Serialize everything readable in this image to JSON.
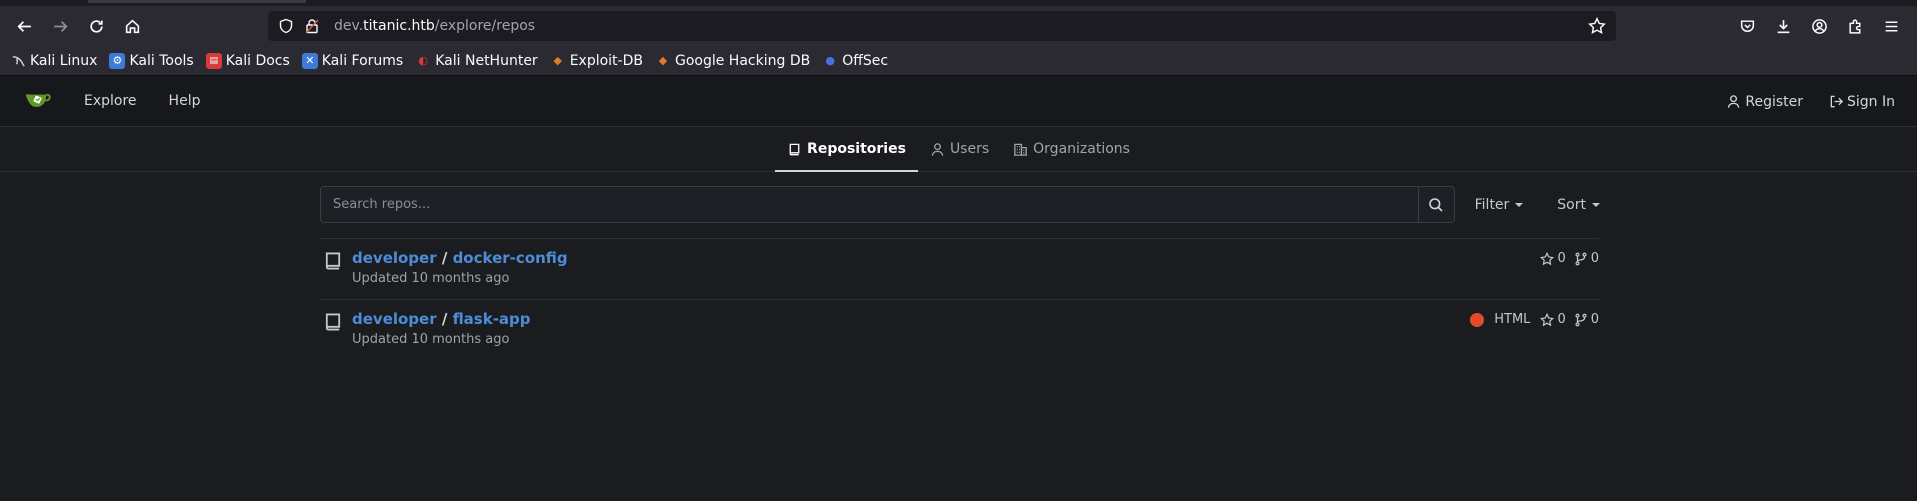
{
  "browser": {
    "url_prefix": "dev.",
    "url_domain": "titanic.htb",
    "url_path": "/explore/repos"
  },
  "bookmarks": [
    {
      "label": "Kali Linux",
      "icon": "kali-dragon-icon",
      "color": "#cfd2d8"
    },
    {
      "label": "Kali Tools",
      "icon": "kali-tools-icon",
      "color": "#3d7bd9"
    },
    {
      "label": "Kali Docs",
      "icon": "kali-docs-icon",
      "color": "#d93b3b"
    },
    {
      "label": "Kali Forums",
      "icon": "kali-forums-icon",
      "color": "#3d7bd9"
    },
    {
      "label": "Kali NetHunter",
      "icon": "nethunter-icon",
      "color": "#d93b3b"
    },
    {
      "label": "Exploit-DB",
      "icon": "exploitdb-icon",
      "color": "#e07a2e"
    },
    {
      "label": "Google Hacking DB",
      "icon": "ghdb-icon",
      "color": "#e07a2e"
    },
    {
      "label": "OffSec",
      "icon": "offsec-icon",
      "color": "#4a6fe0"
    }
  ],
  "header": {
    "explore": "Explore",
    "help": "Help",
    "register": "Register",
    "sign_in": "Sign In"
  },
  "tabs": {
    "repositories": "Repositories",
    "users": "Users",
    "organizations": "Organizations"
  },
  "search": {
    "placeholder": "Search repos...",
    "filter": "Filter",
    "sort": "Sort"
  },
  "repos": [
    {
      "owner": "developer",
      "name": "docker-config",
      "updated": "Updated 10 months ago",
      "language": "",
      "stars": "0",
      "forks": "0"
    },
    {
      "owner": "developer",
      "name": "flask-app",
      "updated": "Updated 10 months ago",
      "language": "HTML",
      "language_color": "#e34c26",
      "stars": "0",
      "forks": "0"
    }
  ],
  "colors": {
    "link": "#4d8cd6",
    "gitea_green": "#609926"
  }
}
